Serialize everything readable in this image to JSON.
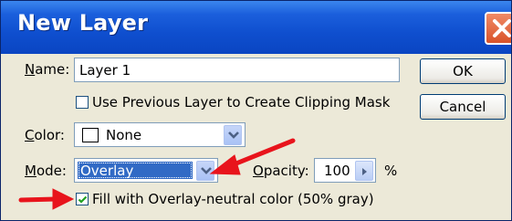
{
  "window": {
    "title": "New Layer"
  },
  "name_field": {
    "label_u": "N",
    "label_rest": "ame:",
    "value": "Layer 1"
  },
  "clipping_mask": {
    "label": "Use Previous Layer to Create Clipping Mask",
    "checked": false
  },
  "color_field": {
    "label_u": "C",
    "label_rest": "olor:",
    "value": "None",
    "swatch": "#ffffff"
  },
  "mode_field": {
    "label_u": "M",
    "label_rest": "ode:",
    "value": "Overlay"
  },
  "opacity_field": {
    "label_u": "O",
    "label_rest": "pacity:",
    "value": "100",
    "unit": "%"
  },
  "fill_neutral": {
    "label": "Fill with Overlay-neutral color (50% gray)",
    "checked": true
  },
  "buttons": {
    "ok": "OK",
    "cancel": "Cancel"
  },
  "colors": {
    "title_bar": "#0f4fcf",
    "dialog_bg": "#ece9d8",
    "selection": "#316ac5",
    "annotation_arrow": "#e8141c"
  }
}
